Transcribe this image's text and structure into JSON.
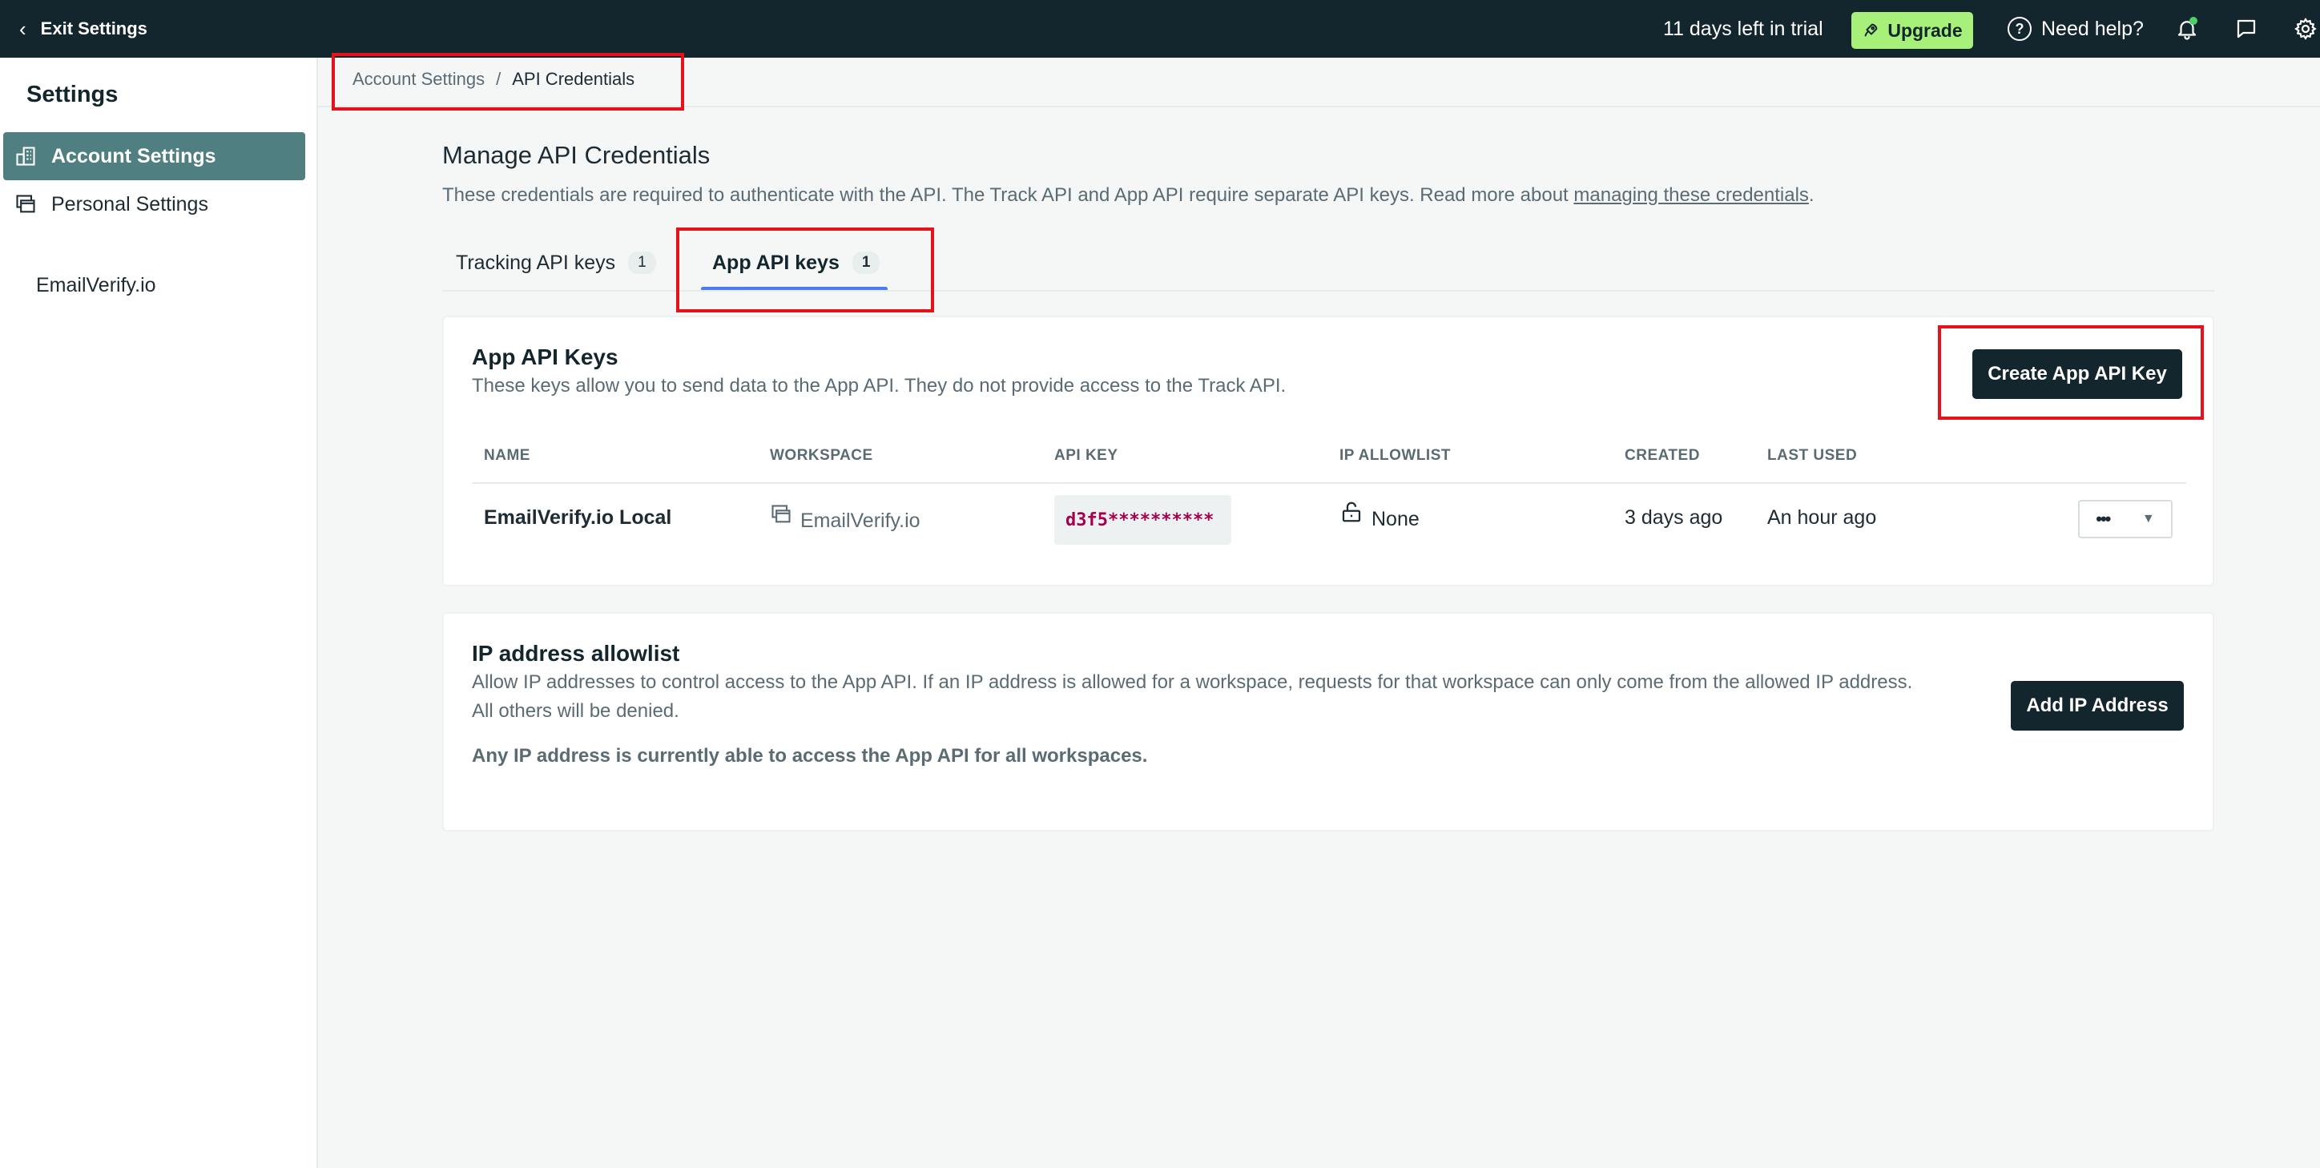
{
  "topbar": {
    "exit_label": "Exit Settings",
    "trial_text": "11 days left in trial",
    "upgrade_label": "Upgrade",
    "help_label": "Need help?",
    "notification_dot_color": "#4ccf64"
  },
  "sidebar": {
    "title": "Settings",
    "items": [
      {
        "label": "Account Settings",
        "icon": "building-icon",
        "active": true
      },
      {
        "label": "Personal Settings",
        "icon": "windows-icon",
        "active": false
      }
    ],
    "workspace": "EmailVerify.io"
  },
  "breadcrumb": {
    "parent": "Account Settings",
    "separator": "/",
    "current": "API Credentials"
  },
  "page": {
    "title": "Manage API Credentials",
    "description": "These credentials are required to authenticate with the API. The Track API and App API require separate API keys. Read more about ",
    "link_text": "managing these credentials",
    "description_end": "."
  },
  "tabs": [
    {
      "label": "Tracking API keys",
      "count": "1",
      "active": false
    },
    {
      "label": "App API keys",
      "count": "1",
      "active": true
    }
  ],
  "app_keys": {
    "title": "App API Keys",
    "description": "These keys allow you to send data to the App API. They do not provide access to the Track API.",
    "create_button": "Create App API Key",
    "columns": [
      "NAME",
      "WORKSPACE",
      "API KEY",
      "IP ALLOWLIST",
      "CREATED",
      "LAST USED"
    ],
    "rows": [
      {
        "name": "EmailVerify.io Local",
        "workspace": "EmailVerify.io",
        "api_key": "d3f5**********",
        "ip_allowlist": "None",
        "created": "3 days ago",
        "last_used": "An hour ago",
        "actions": "•••"
      }
    ]
  },
  "ip_allowlist": {
    "title": "IP address allowlist",
    "description_line1": "Allow IP addresses to control access to the App API. If an IP address is allowed for a workspace, requests for that workspace can only come from the allowed IP address.",
    "description_line2": "All others will be denied.",
    "add_button": "Add IP Address",
    "status_note": "Any IP address is currently able to access the App API for all workspaces."
  },
  "colors": {
    "topbar": "#13252d",
    "sidebar_active": "#4f7f80",
    "upgrade": "#a7f07a",
    "tab_underline": "#4b7bec",
    "highlight_box": "#e5121b",
    "api_key_text": "#a3004f"
  }
}
